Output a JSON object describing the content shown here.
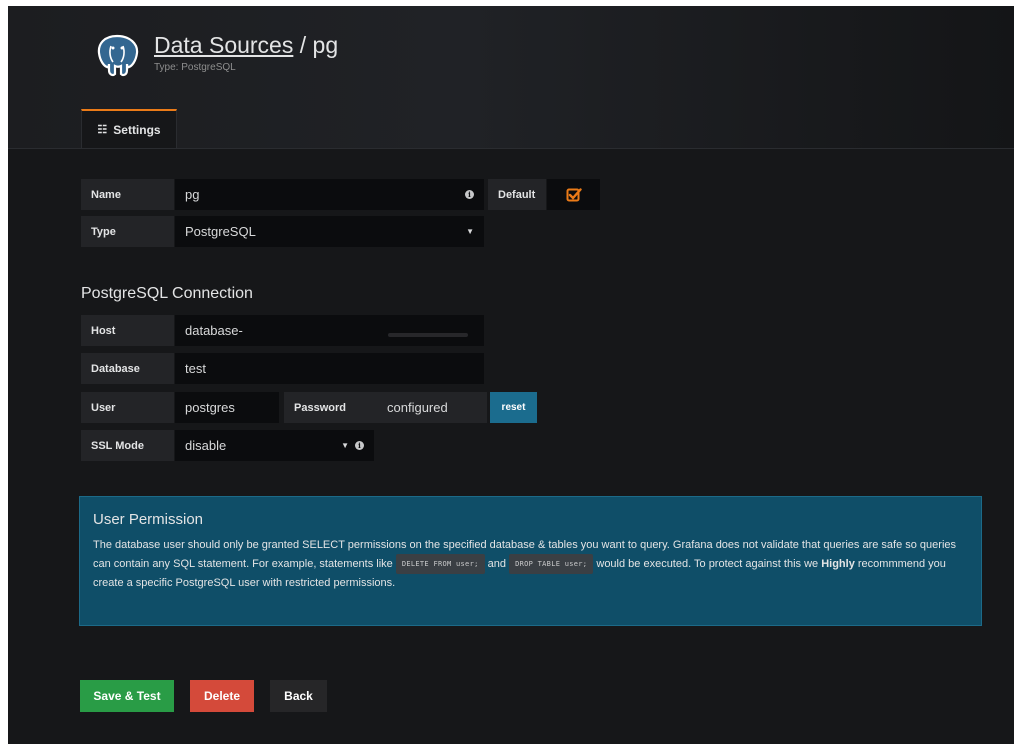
{
  "header": {
    "title_link": "Data Sources",
    "title_sep": " / ",
    "title_name": "pg",
    "subtitle": "Type: PostgreSQL",
    "logo_icon": "postgresql-elephant-icon"
  },
  "tabs": [
    {
      "label": "Settings",
      "icon": "sliders-icon",
      "active": true
    }
  ],
  "general": {
    "name_label": "Name",
    "name_value": "pg",
    "default_label": "Default",
    "default_checked": true,
    "type_label": "Type",
    "type_value": "PostgreSQL"
  },
  "connection": {
    "title": "PostgreSQL Connection",
    "host_label": "Host",
    "host_value": "database-",
    "database_label": "Database",
    "database_value": "test",
    "user_label": "User",
    "user_value": "postgres",
    "password_label": "Password",
    "password_value": "configured",
    "reset_label": "reset",
    "ssl_label": "SSL Mode",
    "ssl_value": "disable"
  },
  "permission": {
    "title": "User Permission",
    "text_1": "The database user should only be granted SELECT permissions on the specified database & tables you want to query. Grafana does not validate that queries are safe so queries can contain any SQL statement. For example, statements like ",
    "code_1": "DELETE FROM user;",
    "text_2": " and ",
    "code_2": "DROP TABLE user;",
    "text_3": " would be executed. To protect against this we ",
    "strong": "Highly",
    "text_4": " recommmend you create a specific PostgreSQL user with restricted permissions."
  },
  "actions": {
    "save_label": "Save & Test",
    "delete_label": "Delete",
    "back_label": "Back"
  },
  "colors": {
    "accent": "#eb7b18",
    "primary": "#299c46",
    "danger": "#d44a3a",
    "info": "#0f4e68",
    "reset": "#1b6c8e"
  }
}
